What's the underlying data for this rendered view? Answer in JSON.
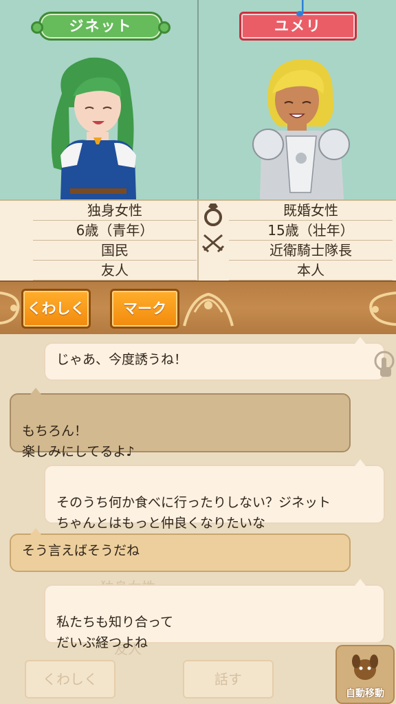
{
  "characters": {
    "left": {
      "name": "ジネット",
      "profile": [
        "独身女性",
        "6歳（青年）",
        "国民",
        "友人"
      ]
    },
    "right": {
      "name": "ユメリ",
      "profile": [
        "既婚女性",
        "15歳（壮年）",
        "近衛騎士隊長",
        "本人"
      ]
    }
  },
  "buttons": {
    "details": "くわしく",
    "mark": "マーク",
    "talk": "話す",
    "auto_move": "自動移動"
  },
  "chat": [
    {
      "side": "right",
      "text": "じゃあ、今度誘うね！"
    },
    {
      "side": "left",
      "text": "もちろん！\n楽しみにしてるよ♪"
    },
    {
      "side": "right",
      "text": "そのうち何か食べに行ったりしない？ジネット\nちゃんとはもっと仲良くなりたいな"
    },
    {
      "side": "left",
      "text": "そう言えばそうだね"
    },
    {
      "side": "right",
      "text": "私たちも知り合って\nだいぶ経つよね"
    }
  ],
  "background_ghost": {
    "profile_text": "独身女性",
    "friend_text": "友人"
  },
  "colors": {
    "portrait_bg": "#a8d5c6",
    "left_nameplate": "#66bb5b",
    "right_nameplate": "#ea5d67",
    "button_orange": "#f28a0e",
    "band_brown": "#c58b4e"
  },
  "icons": {
    "relationship_top": "ring-icon",
    "relationship_bottom": "crossed-swords-icon",
    "music": "music-note-icon",
    "scroll": "hand-pointer-icon"
  }
}
